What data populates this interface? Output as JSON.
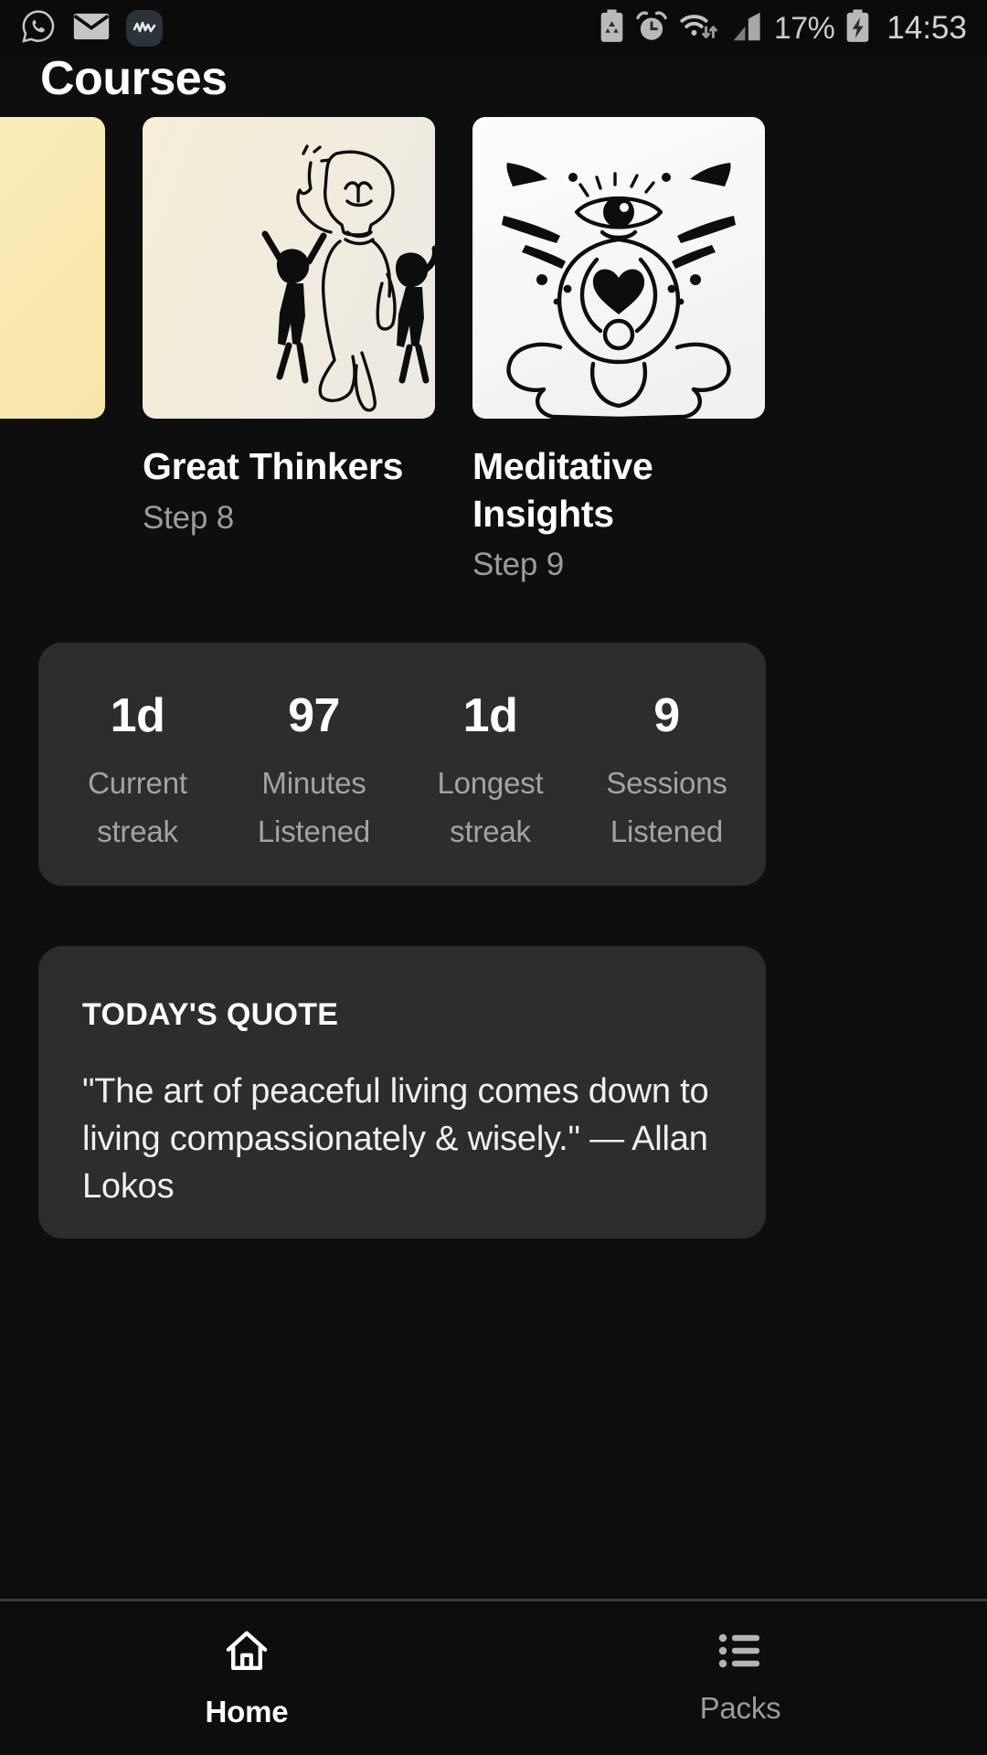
{
  "status_bar": {
    "left_icons": [
      "whatsapp-icon",
      "gmail-icon",
      "app-notification-icon"
    ],
    "right_icons": [
      "battery-saver-icon",
      "alarm-icon",
      "wifi-icon",
      "cell-signal-icon",
      "battery-charging-icon"
    ],
    "battery_percent": "17%",
    "clock": "14:53"
  },
  "header": {
    "title": "Courses"
  },
  "courses": [
    {
      "title": "",
      "step": "",
      "art": "lotus-flower-illustration",
      "bg": "#f7ecb8"
    },
    {
      "title": "Great Thinkers",
      "step": "Step 8",
      "art": "thinker-with-lightbulb-head-illustration",
      "bg": "#f3ecd8"
    },
    {
      "title": "Meditative Insights",
      "step": "Step 9",
      "art": "third-eye-meditation-illustration",
      "bg": "#fafbfb"
    }
  ],
  "stats": [
    {
      "value": "1d",
      "label_line1": "Current",
      "label_line2": "streak"
    },
    {
      "value": "97",
      "label_line1": "Minutes",
      "label_line2": "Listened"
    },
    {
      "value": "1d",
      "label_line1": "Longest",
      "label_line2": "streak"
    },
    {
      "value": "9",
      "label_line1": "Sessions",
      "label_line2": "Listened"
    }
  ],
  "quote": {
    "heading": "TODAY'S QUOTE",
    "text": "\"The art of peaceful living comes down to living compassionately & wisely.\" — Allan Lokos"
  },
  "bottom_nav": [
    {
      "label": "Home",
      "icon": "home-icon",
      "active": true
    },
    {
      "label": "Packs",
      "icon": "list-icon",
      "active": false
    }
  ],
  "colors": {
    "background": "#0e0e0e",
    "card": "#2b2d2f",
    "text_primary": "#ffffff",
    "text_secondary": "#9c9c9c"
  }
}
